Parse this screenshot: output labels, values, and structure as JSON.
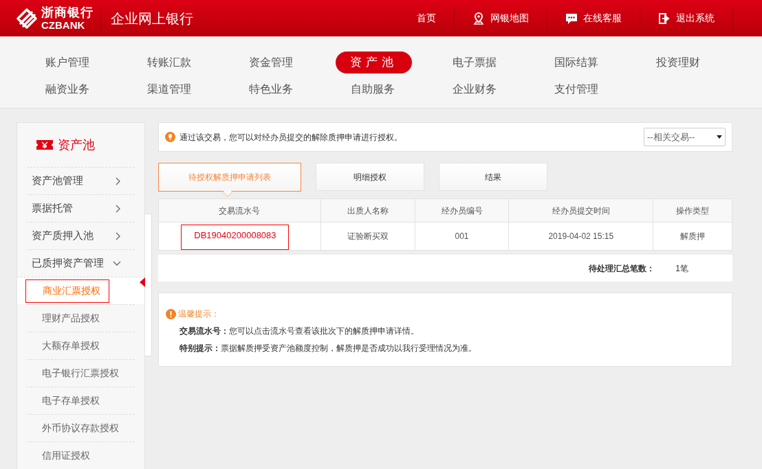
{
  "header": {
    "logo_cn": "浙商银行",
    "logo_en": "CZBANK",
    "title": "企业网上银行",
    "links": [
      {
        "label": "首页",
        "kind": "plain"
      },
      {
        "label": "网银地图",
        "kind": "map"
      },
      {
        "label": "在线客服",
        "kind": "chat"
      },
      {
        "label": "退出系统",
        "kind": "exit"
      }
    ]
  },
  "nav": [
    [
      {
        "label": "账户管理",
        "selected": false
      },
      {
        "label": "转账汇款",
        "selected": false
      },
      {
        "label": "资金管理",
        "selected": false
      },
      {
        "label": "资产池",
        "selected": true
      },
      {
        "label": "电子票据",
        "selected": false
      },
      {
        "label": "国际结算",
        "selected": false
      },
      {
        "label": "投资理财",
        "selected": false
      }
    ],
    [
      {
        "label": "融资业务",
        "selected": false
      },
      {
        "label": "渠道管理",
        "selected": false
      },
      {
        "label": "特色业务",
        "selected": false
      },
      {
        "label": "自助服务",
        "selected": false
      },
      {
        "label": "企业财务",
        "selected": false
      },
      {
        "label": "支付管理",
        "selected": false
      }
    ]
  ],
  "sidebar": {
    "title": "资产池",
    "items": [
      {
        "label": "资产池管理",
        "expanded": false
      },
      {
        "label": "票据托管",
        "expanded": false
      },
      {
        "label": "资产质押入池",
        "expanded": false
      },
      {
        "label": "已质押资产管理",
        "expanded": true,
        "children": [
          {
            "label": "商业汇票授权",
            "selected": true
          },
          {
            "label": "理财产品授权",
            "selected": false
          },
          {
            "label": "大额存单授权",
            "selected": false
          },
          {
            "label": "电子银行汇票授权",
            "selected": false
          },
          {
            "label": "电子存单授权",
            "selected": false
          },
          {
            "label": "外币协议存款授权",
            "selected": false
          },
          {
            "label": "信用证授权",
            "selected": false
          }
        ]
      }
    ]
  },
  "info": {
    "text": "通过该交易，您可以对经办员提交的解除质押申请进行授权。",
    "select": "--相关交易--"
  },
  "steps": [
    {
      "label": "待授权解质押申请列表",
      "selected": true
    },
    {
      "label": "明细授权",
      "selected": false
    },
    {
      "label": "结果",
      "selected": false
    }
  ],
  "table": {
    "columns": [
      "交易流水号",
      "出质人名称",
      "经办员编号",
      "经办员提交时间",
      "操作类型"
    ],
    "rows": [
      {
        "highlighted": true,
        "cells": [
          "DB19040200008083",
          "证验断买双",
          "001",
          "2019-04-02 15:15",
          "解质押"
        ]
      }
    ]
  },
  "summary": {
    "label": "待处理汇总笔数：",
    "value": "1笔"
  },
  "tips": {
    "title": "温馨提示：",
    "lines": [
      "**交易流水号：**您可以点击流水号查看该批次下的解质押申请详情。",
      "**特别提示：**票据解质押受资产池额度控制，解质押是否成功以我行受理情况为准。"
    ]
  }
}
